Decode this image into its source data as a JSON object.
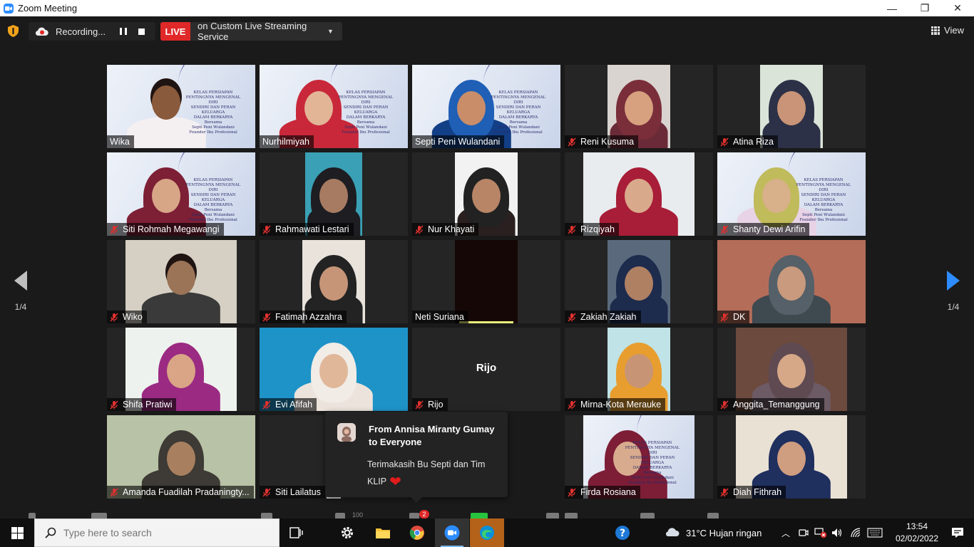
{
  "window": {
    "title": "Zoom Meeting",
    "minimize": "—",
    "maximize": "❐",
    "close": "✕"
  },
  "topbar": {
    "recording_label": "Recording...",
    "live_badge": "LIVE",
    "live_text": "on Custom Live Streaming Service",
    "view_label": "View"
  },
  "gallery": {
    "tiles": [
      {
        "name": "Wika",
        "muted": false,
        "bg": "banner",
        "skin": "#8a5a3c",
        "hijab": "",
        "shirt": "#f4f0f2",
        "active": false,
        "banner": true
      },
      {
        "name": "Nurhilmiyah",
        "muted": false,
        "bg": "banner",
        "skin": "#e2b597",
        "hijab": "#c8283a",
        "shirt": "#c8283a",
        "active": true,
        "banner": true
      },
      {
        "name": "Septi Peni Wulandani",
        "muted": false,
        "bg": "banner",
        "skin": "#c98d69",
        "hijab": "#1f5fb6",
        "shirt": "#123f86",
        "active": false,
        "banner": true
      },
      {
        "name": "Reni Kusuma",
        "muted": true,
        "bg": "#d9d4d0",
        "skin": "#d7a17f",
        "hijab": "#7a2e3a",
        "shirt": "#6a2a38",
        "active": false,
        "narrow": 88
      },
      {
        "name": "Atina Riza",
        "muted": true,
        "bg": "#dbe4d8",
        "skin": "#c99477",
        "hijab": "#2c3147",
        "shirt": "#2c3147",
        "active": false,
        "narrow": 88
      },
      {
        "name": "Siti Rohmah Megawangi",
        "muted": true,
        "bg": "banner",
        "skin": "#d7a687",
        "hijab": "#7d1f35",
        "shirt": "#7d1f35",
        "active": false,
        "banner": true
      },
      {
        "name": "Rahmawati Lestari",
        "muted": true,
        "bg": "#3aa0b5",
        "skin": "#a77b62",
        "hijab": "#1d1d22",
        "shirt": "#1d1d22",
        "active": false,
        "narrow": 80
      },
      {
        "name": "Nur Khayati",
        "muted": true,
        "bg": "#f2f2f2",
        "skin": "#b88567",
        "hijab": "#222",
        "shirt": "#2a2020",
        "active": false,
        "narrow": 88
      },
      {
        "name": "Rizqiyah",
        "muted": true,
        "bg": "#e8ecef",
        "skin": "#d9a98c",
        "hijab": "#a81d37",
        "shirt": "#a81d37",
        "active": false,
        "narrow": 156
      },
      {
        "name": "Shanty Dewi Arifin",
        "muted": true,
        "bg": "banner",
        "skin": "#d8b089",
        "hijab": "#c0bb5b",
        "shirt": "#e8d3e6",
        "active": false,
        "banner": true
      },
      {
        "name": "Wiko",
        "muted": true,
        "bg": "#d6d0c4",
        "skin": "#9b7357",
        "hijab": "",
        "shirt": "#3a3a3a",
        "active": false,
        "narrow": 156
      },
      {
        "name": "Fatimah Azzahra",
        "muted": true,
        "bg": "#e9e3dc",
        "skin": "#c69578",
        "hijab": "#232323",
        "shirt": "#232323",
        "active": false,
        "narrow": 88
      },
      {
        "name": "Neti Suriana",
        "muted": false,
        "bg": "#160707",
        "skin": "",
        "hijab": "",
        "shirt": "",
        "active": false,
        "narrow": 88,
        "speaking": true
      },
      {
        "name": "Zakiah Zakiah",
        "muted": true,
        "bg": "#5a6a7c",
        "skin": "#b08063",
        "hijab": "#1d2b4d",
        "shirt": "#1d2b4d",
        "active": false,
        "narrow": 88
      },
      {
        "name": "DK",
        "muted": true,
        "bg": "#b46d59",
        "skin": "#c99a7d",
        "hijab": "#556068",
        "shirt": "#3f4950",
        "active": false,
        "narrow": 208
      },
      {
        "name": "Shifa Pratiwi",
        "muted": true,
        "bg": "#eef2ee",
        "skin": "#d9a586",
        "hijab": "#9b2a82",
        "shirt": "#9b2a82",
        "active": false,
        "narrow": 156
      },
      {
        "name": "Evi Afifah",
        "muted": true,
        "bg": "#1e93c8",
        "skin": "#e0b799",
        "hijab": "#f1ece6",
        "shirt": "#ece4dc",
        "active": false,
        "narrow": 208
      },
      {
        "name": "Rijo",
        "muted": true,
        "bg": "#252525",
        "skin": "",
        "hijab": "",
        "shirt": "",
        "active": false,
        "initials": "Rijo"
      },
      {
        "name": "Mirna-Kota Merauke",
        "muted": true,
        "bg": "#bfe3e6",
        "skin": "#c79576",
        "hijab": "#e89d2f",
        "shirt": "#e89d2f",
        "active": false,
        "narrow": 88
      },
      {
        "name": "Anggita_Temanggung",
        "muted": true,
        "bg": "#6d4a3e",
        "skin": "#d6a887",
        "hijab": "#5f4a52",
        "shirt": "#6c5a64",
        "active": false,
        "narrow": 156
      },
      {
        "name": "Amanda Fuadilah Pradaningty...",
        "muted": true,
        "bg": "#b8c2a6",
        "skin": "#a8805f",
        "hijab": "#3e3a35",
        "shirt": "#3e3a35",
        "active": false,
        "narrow": 208
      },
      {
        "name": "Siti Lailatus",
        "muted": true,
        "bg": "#ececec",
        "skin": "",
        "hijab": "",
        "shirt": "",
        "active": false,
        "narrow": 20
      },
      {
        "name": "",
        "muted": false,
        "bg": "#252525",
        "skin": "",
        "hijab": "",
        "shirt": "",
        "active": false,
        "hidden": true
      },
      {
        "name": "Firda Rosiana",
        "muted": true,
        "bg": "banner",
        "skin": "#d8ab8e",
        "hijab": "#7d1d36",
        "shirt": "#7d1d36",
        "active": false,
        "banner": true,
        "narrow": 156
      },
      {
        "name": "Diah Fithrah",
        "muted": true,
        "bg": "#e9e1d4",
        "skin": "#cf9d7f",
        "hijab": "#1f2f5e",
        "shirt": "#1f2f5e",
        "active": false,
        "narrow": 156
      }
    ]
  },
  "banner_text": {
    "line1": "KELAS PERSIAPAN",
    "line2": "PENTINGNYA MENGENAL DIRI",
    "line3": "SENDIRI DAN PERAN KELUARGA",
    "line4": "DALAM BERKARYA",
    "line5": "Bersama",
    "line6": "Septi Peni Wulandani",
    "line7": "Founder Ibu Profesional"
  },
  "chat": {
    "from": "From Annisa Miranty Gumay to Everyone",
    "message": "Terimakasih Bu Septi dan Tim KLIP"
  },
  "pager": {
    "left": "1/4",
    "right": "1/4"
  },
  "toolbar": {
    "participants_count": "100",
    "chat_badge": "2"
  },
  "taskbar": {
    "search_placeholder": "Type here to search",
    "weather": "31°C  Hujan ringan",
    "time": "13:54",
    "date": "02/02/2022"
  },
  "colors": {
    "accent": "#2d8cff",
    "live": "#e02828",
    "active_speaker": "#e9f07a",
    "muted": "#e0312f"
  }
}
